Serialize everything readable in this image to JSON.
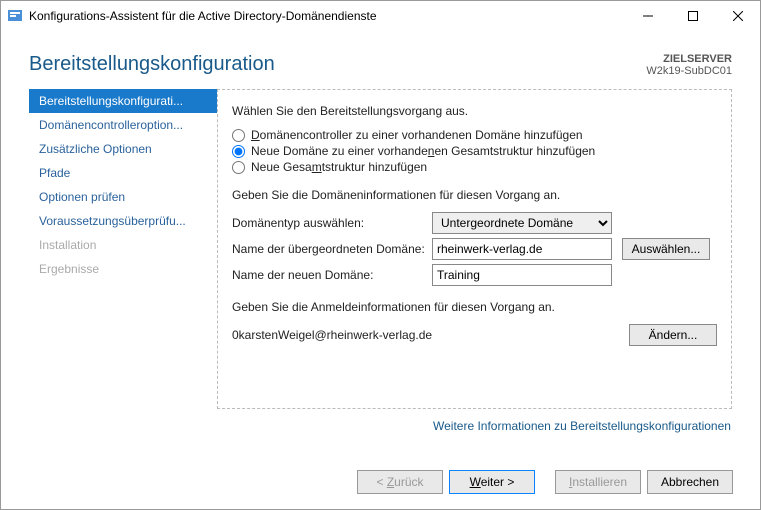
{
  "window": {
    "title": "Konfigurations-Assistent für die Active Directory-Domänendienste"
  },
  "header": {
    "heading": "Bereitstellungskonfiguration",
    "target_label": "ZIELSERVER",
    "target_value": "W2k19-SubDC01"
  },
  "sidebar": {
    "items": [
      {
        "label": "Bereitstellungskonfigurati...",
        "selected": true,
        "disabled": false
      },
      {
        "label": "Domänencontrolleroption...",
        "selected": false,
        "disabled": false
      },
      {
        "label": "Zusätzliche Optionen",
        "selected": false,
        "disabled": false
      },
      {
        "label": "Pfade",
        "selected": false,
        "disabled": false
      },
      {
        "label": "Optionen prüfen",
        "selected": false,
        "disabled": false
      },
      {
        "label": "Voraussetzungsüberprüfu...",
        "selected": false,
        "disabled": false
      },
      {
        "label": "Installation",
        "selected": false,
        "disabled": true
      },
      {
        "label": "Ergebnisse",
        "selected": false,
        "disabled": true
      }
    ]
  },
  "content": {
    "select_op": "Wählen Sie den Bereitstellungsvorgang aus.",
    "radios": {
      "r1": "Domänencontroller zu einer vorhandenen Domäne hinzufügen",
      "r2": "Neue Domäne zu einer vorhandenen Gesamtstruktur hinzufügen",
      "r3": "Neue Gesamtstruktur hinzufügen",
      "selected": "r2"
    },
    "domain_info_label": "Geben Sie die Domäneninformationen für diesen Vorgang an.",
    "domain_type_label": "Domänentyp auswählen:",
    "domain_type_value": "Untergeordnete Domäne",
    "parent_domain_label": "Name der übergeordneten Domäne:",
    "parent_domain_value": "rheinwerk-verlag.de",
    "select_button": "Auswählen...",
    "new_domain_label": "Name der neuen Domäne:",
    "new_domain_value": "Training",
    "cred_section": "Geben Sie die Anmeldeinformationen für diesen Vorgang an.",
    "cred_value": "0karstenWeigel@rheinwerk-verlag.de",
    "change_button": "Ändern...",
    "more_link": "Weitere Informationen zu Bereitstellungskonfigurationen"
  },
  "footer": {
    "back": "< Zurück",
    "next": "Weiter >",
    "install": "Installieren",
    "cancel": "Abbrechen"
  }
}
